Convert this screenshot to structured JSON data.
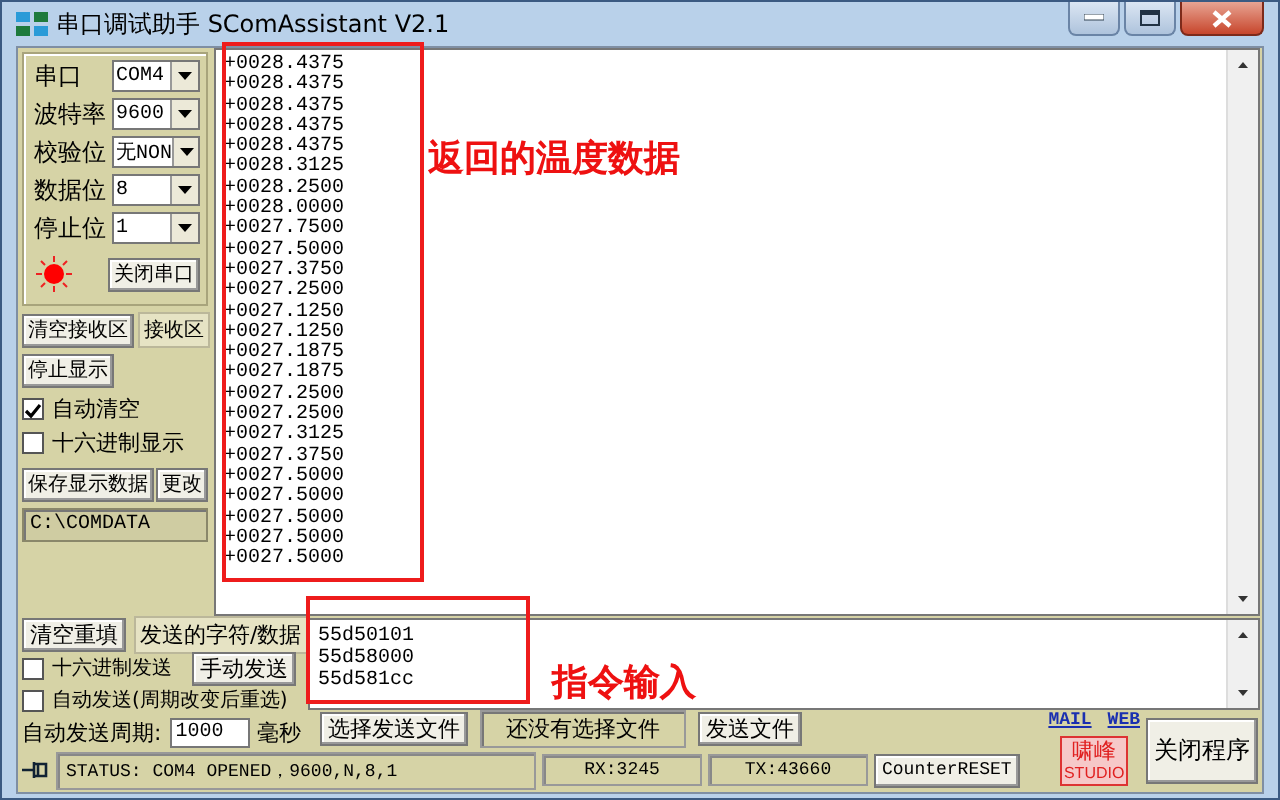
{
  "window": {
    "title": "串口调试助手 SComAssistant V2.1"
  },
  "settings": [
    {
      "label": "串口",
      "value": "COM4"
    },
    {
      "label": "波特率",
      "value": "9600"
    },
    {
      "label": "校验位",
      "value": "无NON"
    },
    {
      "label": "数据位",
      "value": "8"
    },
    {
      "label": "停止位",
      "value": "1"
    }
  ],
  "port_indicator": {
    "on": true
  },
  "close_port_button": "关闭串口",
  "clear_receive_button": "清空接收区",
  "receive_label": "接收区",
  "stop_display_button": "停止显示",
  "receive_options": [
    {
      "label": "自动清空",
      "checked": true
    },
    {
      "label": "十六进制显示",
      "checked": false
    }
  ],
  "save_button": "保存显示数据",
  "change_button": "更改",
  "save_path": "C:\\COMDATA",
  "received": [
    "+0028.4375",
    "+0028.4375",
    "+0028.4375",
    "+0028.4375",
    "+0028.4375",
    "+0028.3125",
    "+0028.2500",
    "+0028.0000",
    "+0027.7500",
    "+0027.5000",
    "+0027.3750",
    "+0027.2500",
    "+0027.1250",
    "+0027.1250",
    "+0027.1875",
    "+0027.1875",
    "+0027.2500",
    "+0027.2500",
    "+0027.3125",
    "+0027.3750",
    "+0027.5000",
    "+0027.5000",
    "+0027.5000",
    "+0027.5000",
    "+0027.5000"
  ],
  "send": {
    "clear_button": "清空重填",
    "label": "发送的字符/数据",
    "hex_send": {
      "label": "十六进制发送",
      "checked": false
    },
    "manual_send_button": "手动发送",
    "auto_send": {
      "label": "自动发送(周期改变后重选)",
      "checked": false
    },
    "period_label": "自动发送周期:",
    "period": "1000",
    "period_unit": "毫秒",
    "lines": [
      "55d50101",
      "55d58000",
      "55d581cc"
    ],
    "choose_file_button": "选择发送文件",
    "file_status": "还没有选择文件",
    "send_file_button": "发送文件"
  },
  "links": [
    "MAIL",
    "WEB"
  ],
  "logo": [
    "啸峰",
    "STUDIO"
  ],
  "exit_button": "关闭程序",
  "status_bar": {
    "status": "STATUS: COM4 OPENED，9600,N,8,1",
    "rx": "RX:3245",
    "tx": "TX:43660",
    "reset_button": "CounterRESET"
  },
  "annotations": [
    {
      "text": "返回的温度数据"
    },
    {
      "text": "指令输入"
    }
  ]
}
